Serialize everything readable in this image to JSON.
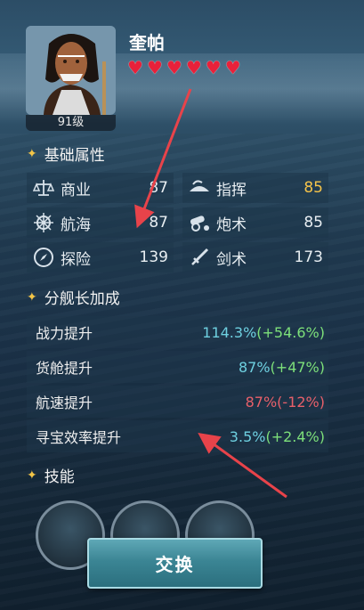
{
  "character": {
    "name": "奎帕",
    "level": "91级",
    "hearts": 6
  },
  "basic": {
    "title": "基础属性",
    "stats": [
      {
        "label": "商业",
        "value": "87",
        "icon": "scale-icon"
      },
      {
        "label": "指挥",
        "value": "85",
        "icon": "command-hat-icon"
      },
      {
        "label": "航海",
        "value": "87",
        "icon": "ship-wheel-icon"
      },
      {
        "label": "炮术",
        "value": "85",
        "icon": "cannon-icon"
      },
      {
        "label": "探险",
        "value": "139",
        "icon": "compass-icon"
      },
      {
        "label": "剑术",
        "value": "173",
        "icon": "sword-icon"
      }
    ]
  },
  "fleet": {
    "title": "分舰长加成",
    "rows": [
      {
        "label": "战力提升",
        "base": "114.3%",
        "bonus": "(+54.6%)"
      },
      {
        "label": "货舱提升",
        "base": "87%",
        "bonus": "(+47%)"
      },
      {
        "label": "航速提升",
        "base": "87%",
        "bonus": "(-12%)"
      },
      {
        "label": "寻宝效率提升",
        "base": "3.5%",
        "bonus": "(+2.4%)"
      }
    ]
  },
  "skills": {
    "title": "技能"
  },
  "actions": {
    "swap_label": "交换"
  },
  "colors": {
    "accent_gold": "#f4c34a",
    "positive": "#7de07a",
    "negative": "#e8606a",
    "base_value": "#6ed0e0",
    "heart": "#e8213a",
    "arrow": "#e8434a"
  }
}
